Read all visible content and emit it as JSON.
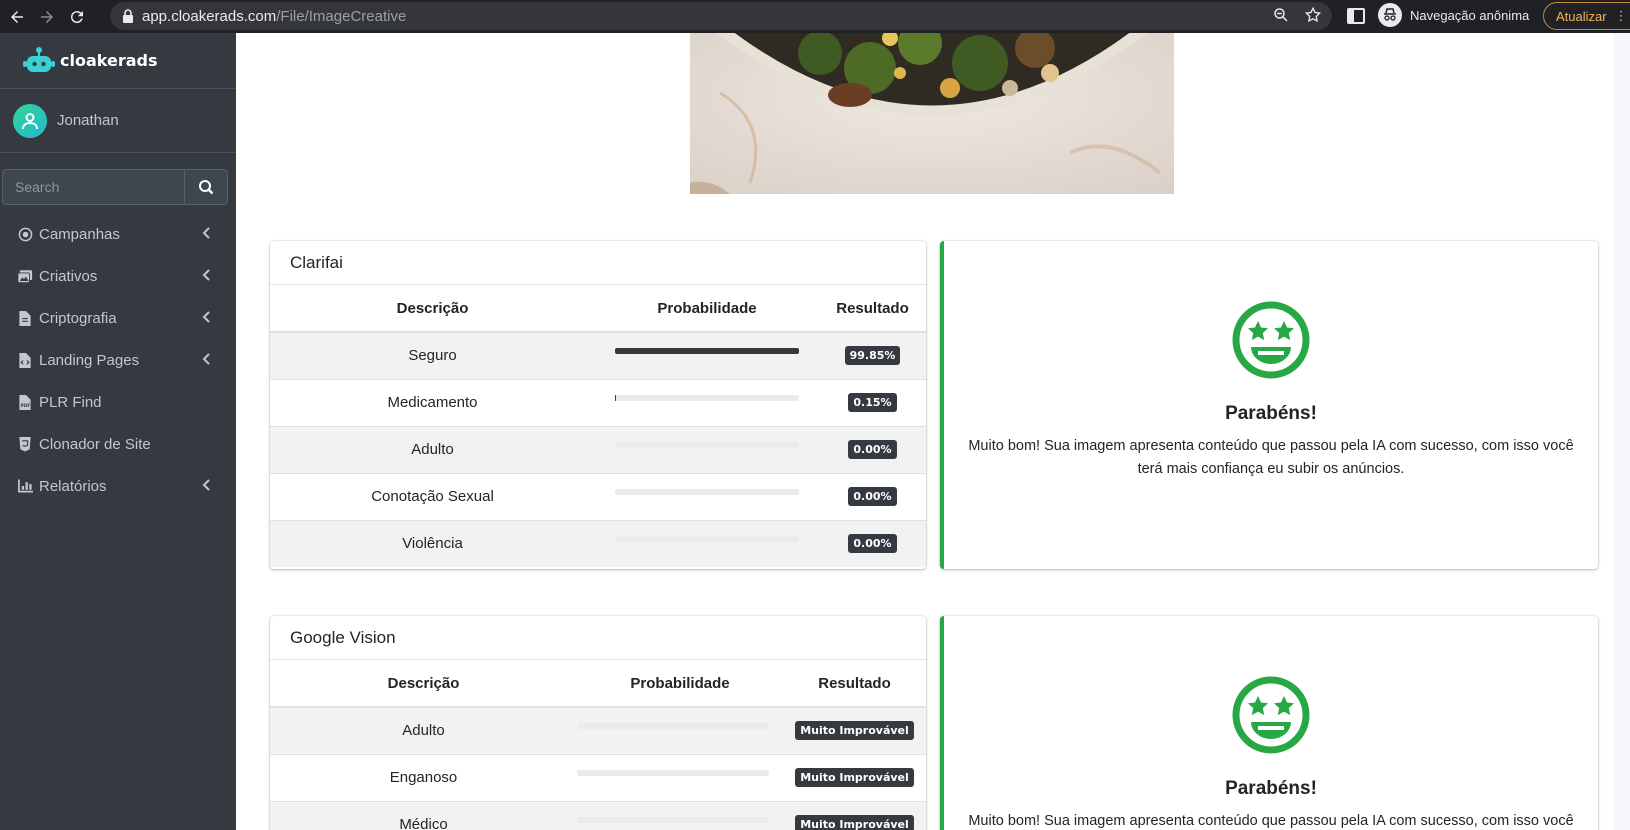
{
  "browser": {
    "url_host": "app.cloakerads.com",
    "url_path": "/File/ImageCreative",
    "incognito_label": "Navegação anônima",
    "update_label": "Atualizar"
  },
  "sidebar": {
    "brand": "cloakerads",
    "user": "Jonathan",
    "search_placeholder": "Search",
    "items": [
      {
        "label": "Campanhas",
        "icon": "circle-dot-icon",
        "has_submenu": true
      },
      {
        "label": "Criativos",
        "icon": "images-icon",
        "has_submenu": true
      },
      {
        "label": "Criptografia",
        "icon": "file-icon",
        "has_submenu": true
      },
      {
        "label": "Landing Pages",
        "icon": "file-code-icon",
        "has_submenu": true
      },
      {
        "label": "PLR Find",
        "icon": "file-pdf-icon",
        "has_submenu": false
      },
      {
        "label": "Clonador de Site",
        "icon": "html5-icon",
        "has_submenu": false
      },
      {
        "label": "Relatórios",
        "icon": "chart-bar-icon",
        "has_submenu": true
      }
    ]
  },
  "clarifai": {
    "title": "Clarifai",
    "columns": [
      "Descrição",
      "Probabilidade",
      "Resultado"
    ],
    "rows": [
      {
        "label": "Seguro",
        "prob": 0.9985,
        "result": "99.85%"
      },
      {
        "label": "Medicamento",
        "prob": 0.0015,
        "result": "0.15%"
      },
      {
        "label": "Adulto",
        "prob": 0,
        "result": "0.00%"
      },
      {
        "label": "Conotação Sexual",
        "prob": 0,
        "result": "0.00%"
      },
      {
        "label": "Violência",
        "prob": 0,
        "result": "0.00%"
      }
    ],
    "result_title": "Parabéns!",
    "result_text": "Muito bom! Sua imagem apresenta conteúdo que passou pela IA com sucesso, com isso você terá mais confiança eu subir os anúncios."
  },
  "google_vision": {
    "title": "Google Vision",
    "columns": [
      "Descrição",
      "Probabilidade",
      "Resultado"
    ],
    "rows": [
      {
        "label": "Adulto",
        "prob": 0,
        "result": "Muito Improvável"
      },
      {
        "label": "Enganoso",
        "prob": 0,
        "result": "Muito Improvável"
      },
      {
        "label": "Médico",
        "prob": 0,
        "result": "Muito Improvável"
      }
    ],
    "result_title": "Parabéns!",
    "result_text": "Muito bom! Sua imagem apresenta conteúdo que passou pela IA com sucesso, com isso você"
  },
  "colors": {
    "success": "#28a745",
    "sidebar": "#343a40"
  }
}
